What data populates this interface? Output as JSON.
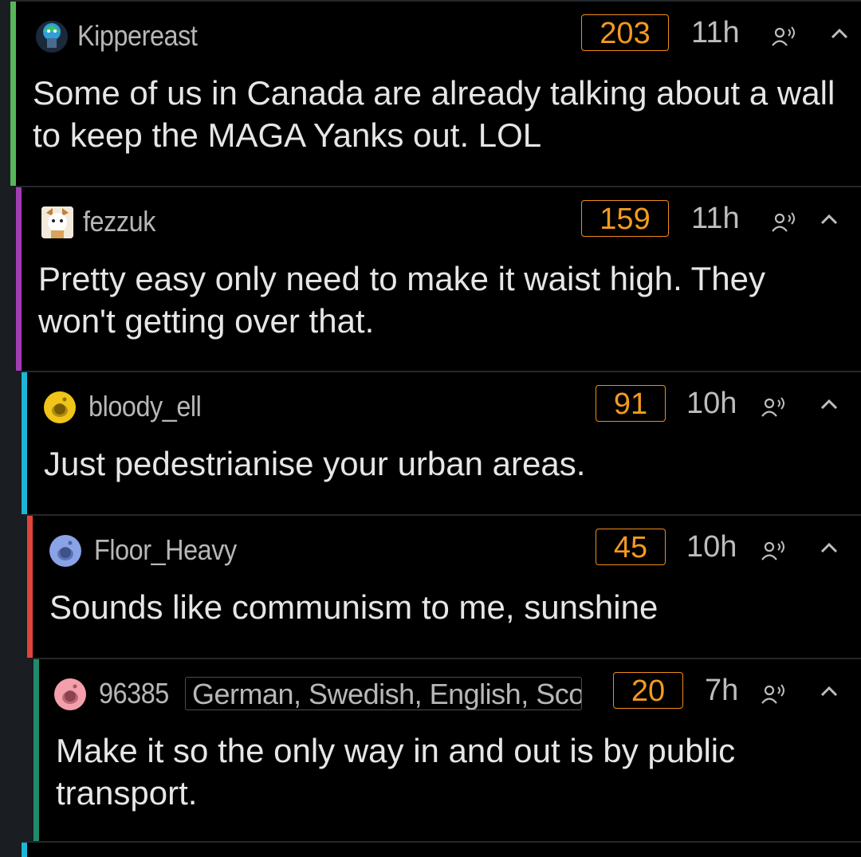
{
  "comments": [
    {
      "username": "Kippereast",
      "flair": "",
      "score": "203",
      "time": "11h",
      "text": "Some of us in Canada are already talking about a wall to keep the MAGA Yanks out. LOL",
      "depth_color": "#57b55a",
      "avatar": "custom-avatar-icon"
    },
    {
      "username": "fezzuk",
      "flair": "",
      "score": "159",
      "time": "11h",
      "text": "Pretty easy only need to make it waist high. They won't getting over that.",
      "depth_color": "#a23db3",
      "avatar": "custom-avatar-icon"
    },
    {
      "username": "bloody_ell",
      "flair": "",
      "score": "91",
      "time": "10h",
      "text": "Just pedestrianise your urban areas.",
      "depth_color": "#1ab7d6",
      "avatar": "snoo-avatar-icon"
    },
    {
      "username": "Floor_Heavy",
      "flair": "",
      "score": "45",
      "time": "10h",
      "text": "Sounds like communism to me, sunshine",
      "depth_color": "#e0443a",
      "avatar": "snoo-avatar-icon"
    },
    {
      "username": "96385",
      "flair": "German, Swedish, English, Scot",
      "score": "20",
      "time": "7h",
      "text": "Make it so the only way in and out is by public transport.",
      "depth_color": "#1f8a6e",
      "avatar": "snoo-avatar-icon"
    }
  ],
  "next_comment": {
    "depth_color": "#1ab7d6"
  }
}
